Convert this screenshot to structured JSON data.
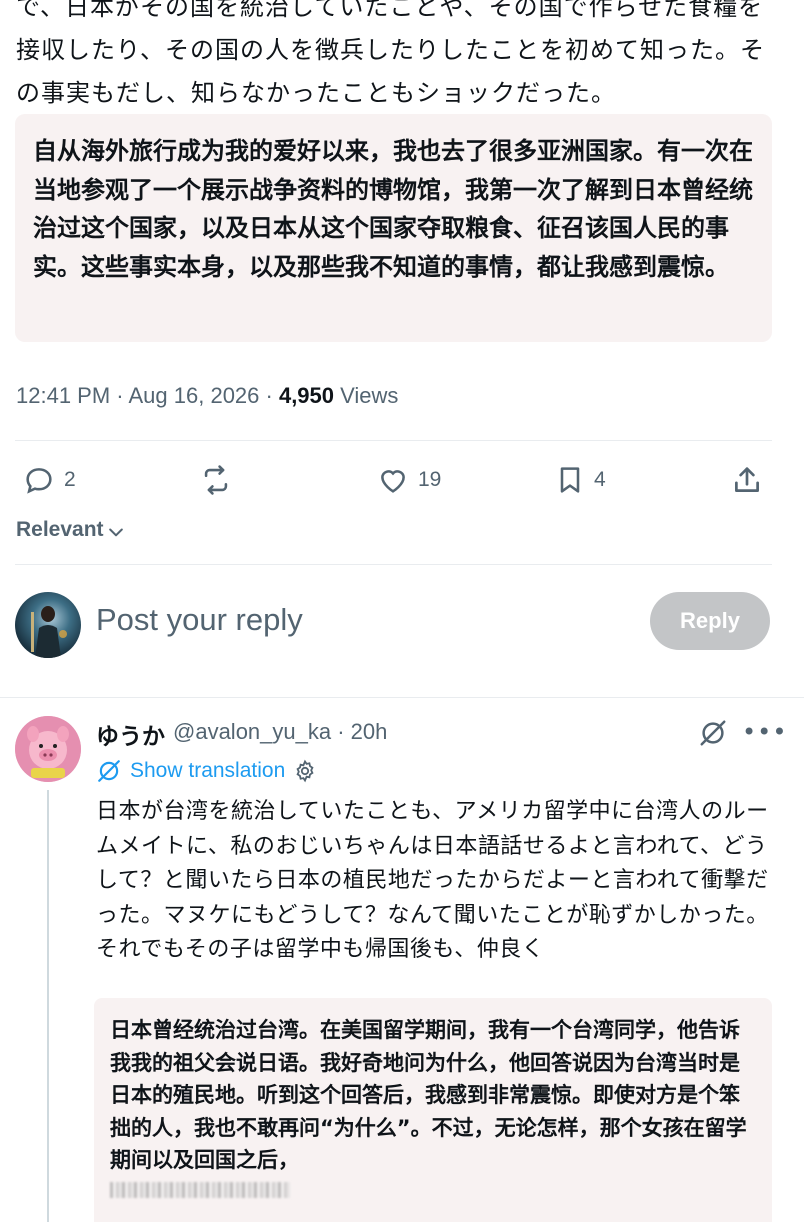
{
  "tweet": {
    "original_text": "で、日本がその国を統治していたことや、その国で作らせた食糧を接収したり、その国の人を徴兵したりしたことを初めて知った。その事実もだし、知らなかったこともショックだった。",
    "translation": "自从海外旅行成为我的爱好以来，我也去了很多亚洲国家。有一次在当地参观了一个展示战争资料的博物馆，我第一次了解到日本曾经统治过这个国家，以及日本从这个国家夺取粮食、征召该国人民的事实。这些事实本身，以及那些我不知道的事情，都让我感到震惊。",
    "time": "12:41 PM · Aug 16, 2026 · ",
    "views_count": "4,950",
    "views_label": " Views"
  },
  "actions": {
    "reply_count": "2",
    "retweet_count": "",
    "like_count": "19",
    "bookmark_count": "4"
  },
  "sort": {
    "label": "Relevant"
  },
  "composer": {
    "placeholder": "Post your reply",
    "button_label": "Reply"
  },
  "reply": {
    "display_name": "ゆうか",
    "handle_time": "@avalon_yu_ka · 20h",
    "show_translation": "Show translation",
    "text": "日本が台湾を統治していたことも、アメリカ留学中に台湾人のルームメイトに、私のおじいちゃんは日本語話せるよと言われて、どうして？と聞いたら日本の植民地だったからだよーと言われて衝撃だった。マヌケにもどうして？なんて聞いたことが恥ずかしかった。それでもその子は留学中も帰国後も、仲良く",
    "translation": "日本曾经统治过台湾。在美国留学期间，我有一个台湾同学，他告诉我我的祖父会说日语。我好奇地问为什么，他回答说因为台湾当时是日本的殖民地。听到这个回答后，我感到非常震惊。即使对方是个笨拙的人，我也不敢再问“为什么”。不过，无论怎样，那个女孩在留学期间以及回国之后，"
  },
  "colors": {
    "text": "#0f1419",
    "muted": "#536471",
    "link": "#1d9bf0",
    "translation_bg": "#f8f2f2",
    "reply_button_disabled": "#c3c5c7"
  }
}
